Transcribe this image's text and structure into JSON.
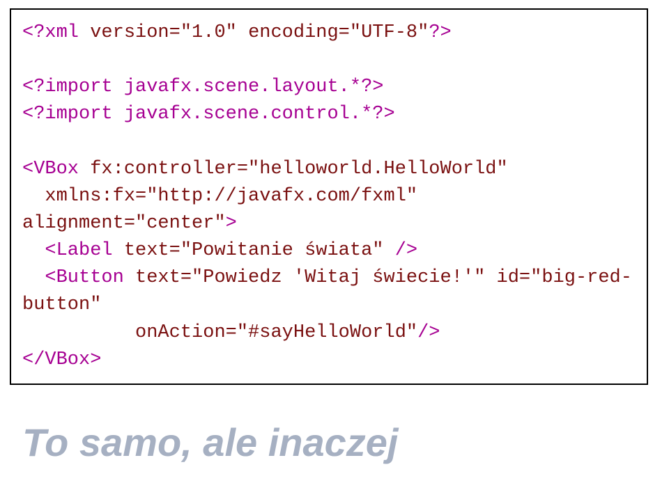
{
  "code": {
    "line1_a": "<?xml ",
    "line1_b": "version=\"1.0\"",
    "line1_c": " ",
    "line1_d": "encoding=\"UTF-8\"",
    "line1_e": "?>",
    "blank1": " ",
    "line2": "<?import javafx.scene.layout.*?>",
    "line3": "<?import javafx.scene.control.*?>",
    "blank2": " ",
    "line4_a": "<VBox ",
    "line4_b": "fx:controller=\"helloworld.HelloWorld\"",
    "line5_ind": "  ",
    "line5_a": "xmlns:fx=\"http://javafx.com/fxml\"",
    "line5_b": " ",
    "line5_c": "alignment=\"center\"",
    "line5_d": ">",
    "line6_ind": "  ",
    "line6_a": "<Label ",
    "line6_b": "text=\"Powitanie świata\"",
    "line6_c": " />",
    "line7_ind": "  ",
    "line7_a": "<Button ",
    "line7_b": "text=\"Powiedz 'Witaj świecie!'\"",
    "line7_c": " ",
    "line7_d": "id=\"big-red-button\"",
    "line8_ind": "          ",
    "line8_a": "onAction=\"#sayHelloWorld\"",
    "line8_b": "/>",
    "line9": "</VBox>"
  },
  "heading": "To samo, ale inaczej"
}
